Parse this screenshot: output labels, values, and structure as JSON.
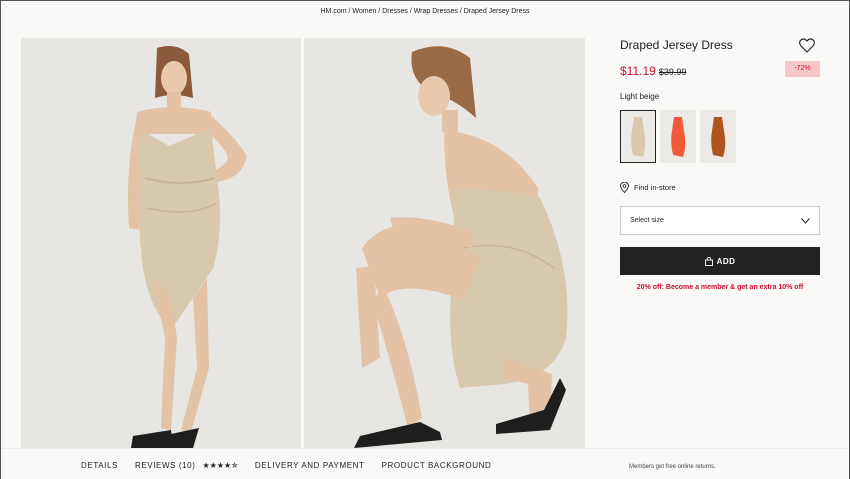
{
  "breadcrumb": "HM.com / Women / Dresses / Wrap Dresses / Draped Jersey Dress",
  "product": {
    "title": "Draped Jersey Dress",
    "price_now": "$11.19",
    "price_old": "$39.99",
    "discount": "-72%",
    "color_name": "Light beige",
    "swatches": [
      {
        "color": "#d8c8ae",
        "selected": true
      },
      {
        "color": "#f05a3a",
        "selected": false
      },
      {
        "color": "#b0541d",
        "selected": false
      }
    ],
    "find_in_store": "Find in-store",
    "select_size": "Select size",
    "add_label": "ADD",
    "promo": "20% off: Become a member & get an extra 10% off"
  },
  "tabs": {
    "details": "DETAILS",
    "reviews": "REVIEWS (10)",
    "stars": "★★★★✯",
    "rating": 4.5,
    "delivery": "DELIVERY AND PAYMENT",
    "background": "PRODUCT BACKGROUND"
  },
  "returns_note": "Members get free online returns.",
  "colors": {
    "accent_red": "#c8102e",
    "dark": "#222222",
    "dress_beige": "#d8c8ae"
  }
}
